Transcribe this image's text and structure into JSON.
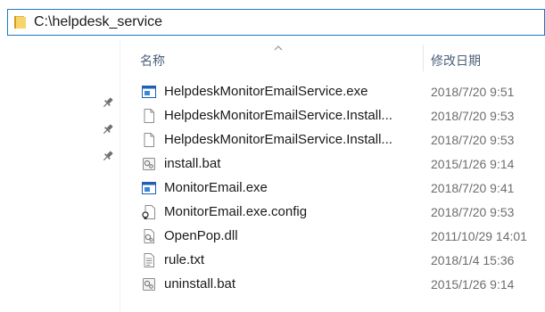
{
  "address": {
    "path": "C:\\helpdesk_service",
    "icon": "folder-icon"
  },
  "columns": {
    "name": "名称",
    "date_modified": "修改日期"
  },
  "nav_pane": {
    "pins": [
      "pin-icon",
      "pin-icon",
      "pin-icon"
    ]
  },
  "files": [
    {
      "name": "HelpdeskMonitorEmailService.exe",
      "date": "2018/7/20 9:51",
      "icon": "exe-icon"
    },
    {
      "name": "HelpdeskMonitorEmailService.Install...",
      "date": "2018/7/20 9:53",
      "icon": "document-icon"
    },
    {
      "name": "HelpdeskMonitorEmailService.Install...",
      "date": "2018/7/20 9:53",
      "icon": "document-icon"
    },
    {
      "name": "install.bat",
      "date": "2015/1/26 9:14",
      "icon": "batch-file-icon"
    },
    {
      "name": "MonitorEmail.exe",
      "date": "2018/7/20 9:41",
      "icon": "exe-icon"
    },
    {
      "name": "MonitorEmail.exe.config",
      "date": "2018/7/20 9:53",
      "icon": "config-file-icon"
    },
    {
      "name": "OpenPop.dll",
      "date": "2011/10/29 14:01",
      "icon": "dll-icon"
    },
    {
      "name": "rule.txt",
      "date": "2018/1/4 15:36",
      "icon": "text-file-icon"
    },
    {
      "name": "uninstall.bat",
      "date": "2015/1/26 9:14",
      "icon": "batch-file-icon"
    }
  ],
  "colors": {
    "address_border": "#1979ca",
    "header_text": "#4c607a",
    "date_text": "#6d6d6d",
    "exe_accent": "#1f5fb4",
    "folder_yellow": "#f0c24b"
  }
}
